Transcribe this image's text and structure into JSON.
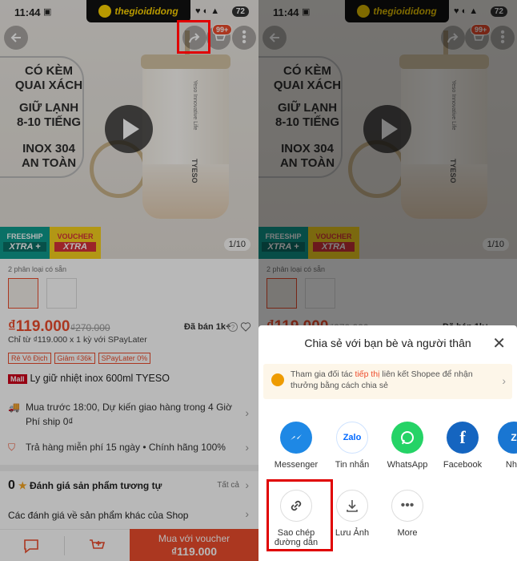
{
  "status": {
    "time": "11:44",
    "battery": "72"
  },
  "brand": "thegioididong",
  "cart_badge": "99+",
  "promo": {
    "line1": "CÓ KÈM",
    "line2": "QUAI XÁCH",
    "line3": "GIỮ LẠNH",
    "line4": "8-10 TIẾNG",
    "line5": "INOX 304",
    "line6": "AN TOÀN"
  },
  "bottle": {
    "side_text": "Yeso Innovative Life",
    "brand": "TYESO"
  },
  "tags": {
    "freeship_top": "FREESHIP",
    "freeship_big": "XTRA +",
    "voucher_top": "VOUCHER",
    "voucher_big": "XTRA"
  },
  "image_counter": "1/10",
  "variants_label": "2 phân loại có sẵn",
  "price": "₫119.000",
  "old_price": "₫270.000",
  "sold": "Đã bán 1k+",
  "installment": "Chỉ từ ₫119.000 x 1 kỳ với SPayLater",
  "badges": [
    "Rẻ Vô Địch",
    "Giảm ₫36k",
    "SPayLater 0%"
  ],
  "mall": "Mall",
  "title": "Ly giữ nhiệt inox 600ml TYESO",
  "shipping": {
    "line1": "Mua trước 18:00, Dự kiến giao hàng trong 4 Giờ",
    "line2": "Phí ship 0₫"
  },
  "returns": "Trả hàng miễn phí 15 ngày • Chính hãng 100%",
  "rating": {
    "score": "0",
    "label": "Đánh giá sản phẩm tương tự",
    "all": "Tất cả"
  },
  "other_reviews": "Các đánh giá về sản phẩm khác của Shop",
  "buy": {
    "label": "Mua với voucher",
    "price": "₫119.000"
  },
  "sheet": {
    "title": "Chia sẻ với bạn bè và người thân",
    "affiliate_pre": "Tham gia đối tác ",
    "affiliate_link": "tiếp thị",
    "affiliate_post": " liên kết Shopee để nhận thưởng bằng cách chia sẻ",
    "apps": [
      {
        "name": "Messenger",
        "color": "#1e88e5",
        "glyph": "m"
      },
      {
        "name": "Tin nhắn",
        "color": "#ffffff",
        "glyph": "Zalo"
      },
      {
        "name": "WhatsApp",
        "color": "#25d366",
        "glyph": "W"
      },
      {
        "name": "Facebook",
        "color": "#1565c0",
        "glyph": "f"
      },
      {
        "name": "Nhắ",
        "color": "#1976d2",
        "glyph": "Z"
      }
    ],
    "actions": [
      {
        "name": "Sao chép đường dẫn",
        "icon": "link-icon"
      },
      {
        "name": "Lưu Ảnh",
        "icon": "download-icon"
      },
      {
        "name": "More",
        "icon": "more-icon"
      }
    ]
  },
  "colors": {
    "accent": "#ee4d2d",
    "highlight": "#e00000"
  }
}
